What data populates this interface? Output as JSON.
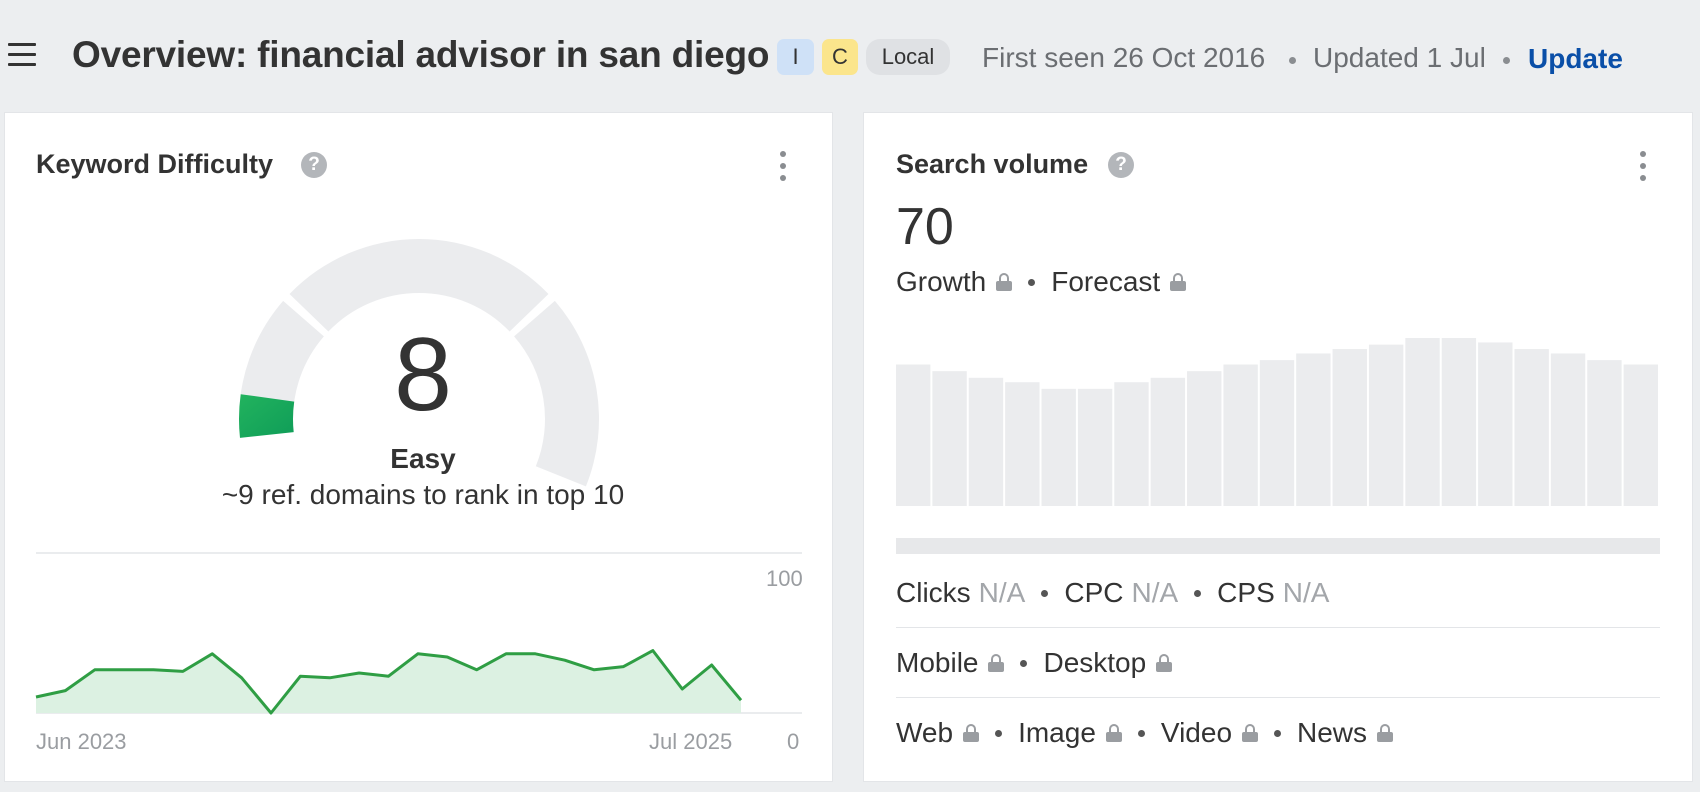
{
  "header": {
    "title": "Overview: financial advisor in san diego",
    "badges": [
      "I",
      "C",
      "Local"
    ],
    "first_seen": "First seen 26 Oct 2016",
    "updated": "Updated 1 Jul",
    "update_label": "Update"
  },
  "kd_card": {
    "title": "Keyword Difficulty",
    "help": "?",
    "value": "8",
    "label": "Easy",
    "subtitle": "~9 ref. domains to rank in top 10",
    "gauge_value": 8,
    "gauge_max": 100,
    "colors": {
      "accent": "#0f9d58",
      "track": "#ebecee",
      "line": "#2f9e44",
      "fill": "#dcf1e2"
    },
    "chart": {
      "x_start": "Jun 2023",
      "x_end": "Jul 2025",
      "y_max_label": "100",
      "y_min_label": "0"
    }
  },
  "sv_card": {
    "title": "Search volume",
    "help": "?",
    "value": "70",
    "growth": "Growth",
    "forecast": "Forecast",
    "clicks_label": "Clicks",
    "clicks_value": "N/A",
    "cpc_label": "CPC",
    "cpc_value": "N/A",
    "cps_label": "CPS",
    "cps_value": "N/A",
    "mobile": "Mobile",
    "desktop": "Desktop",
    "web": "Web",
    "image": "Image",
    "video": "Video",
    "news": "News"
  },
  "chart_data": [
    {
      "type": "area",
      "x_labels": [
        "Jun 2023",
        "Jul 2025"
      ],
      "ylim": [
        0,
        100
      ],
      "y_tick_labels": [
        "0",
        "100"
      ],
      "values": [
        10,
        14,
        27,
        27,
        27,
        26,
        37,
        22,
        0,
        23,
        22,
        25,
        23,
        37,
        35,
        27,
        37,
        37,
        33,
        27,
        29,
        39,
        15,
        30,
        8
      ]
    },
    {
      "type": "bar",
      "values": [
        64,
        61,
        58,
        56,
        53,
        53,
        56,
        58,
        61,
        64,
        66,
        69,
        71,
        73,
        76,
        76,
        74,
        71,
        69,
        66,
        64
      ]
    }
  ]
}
